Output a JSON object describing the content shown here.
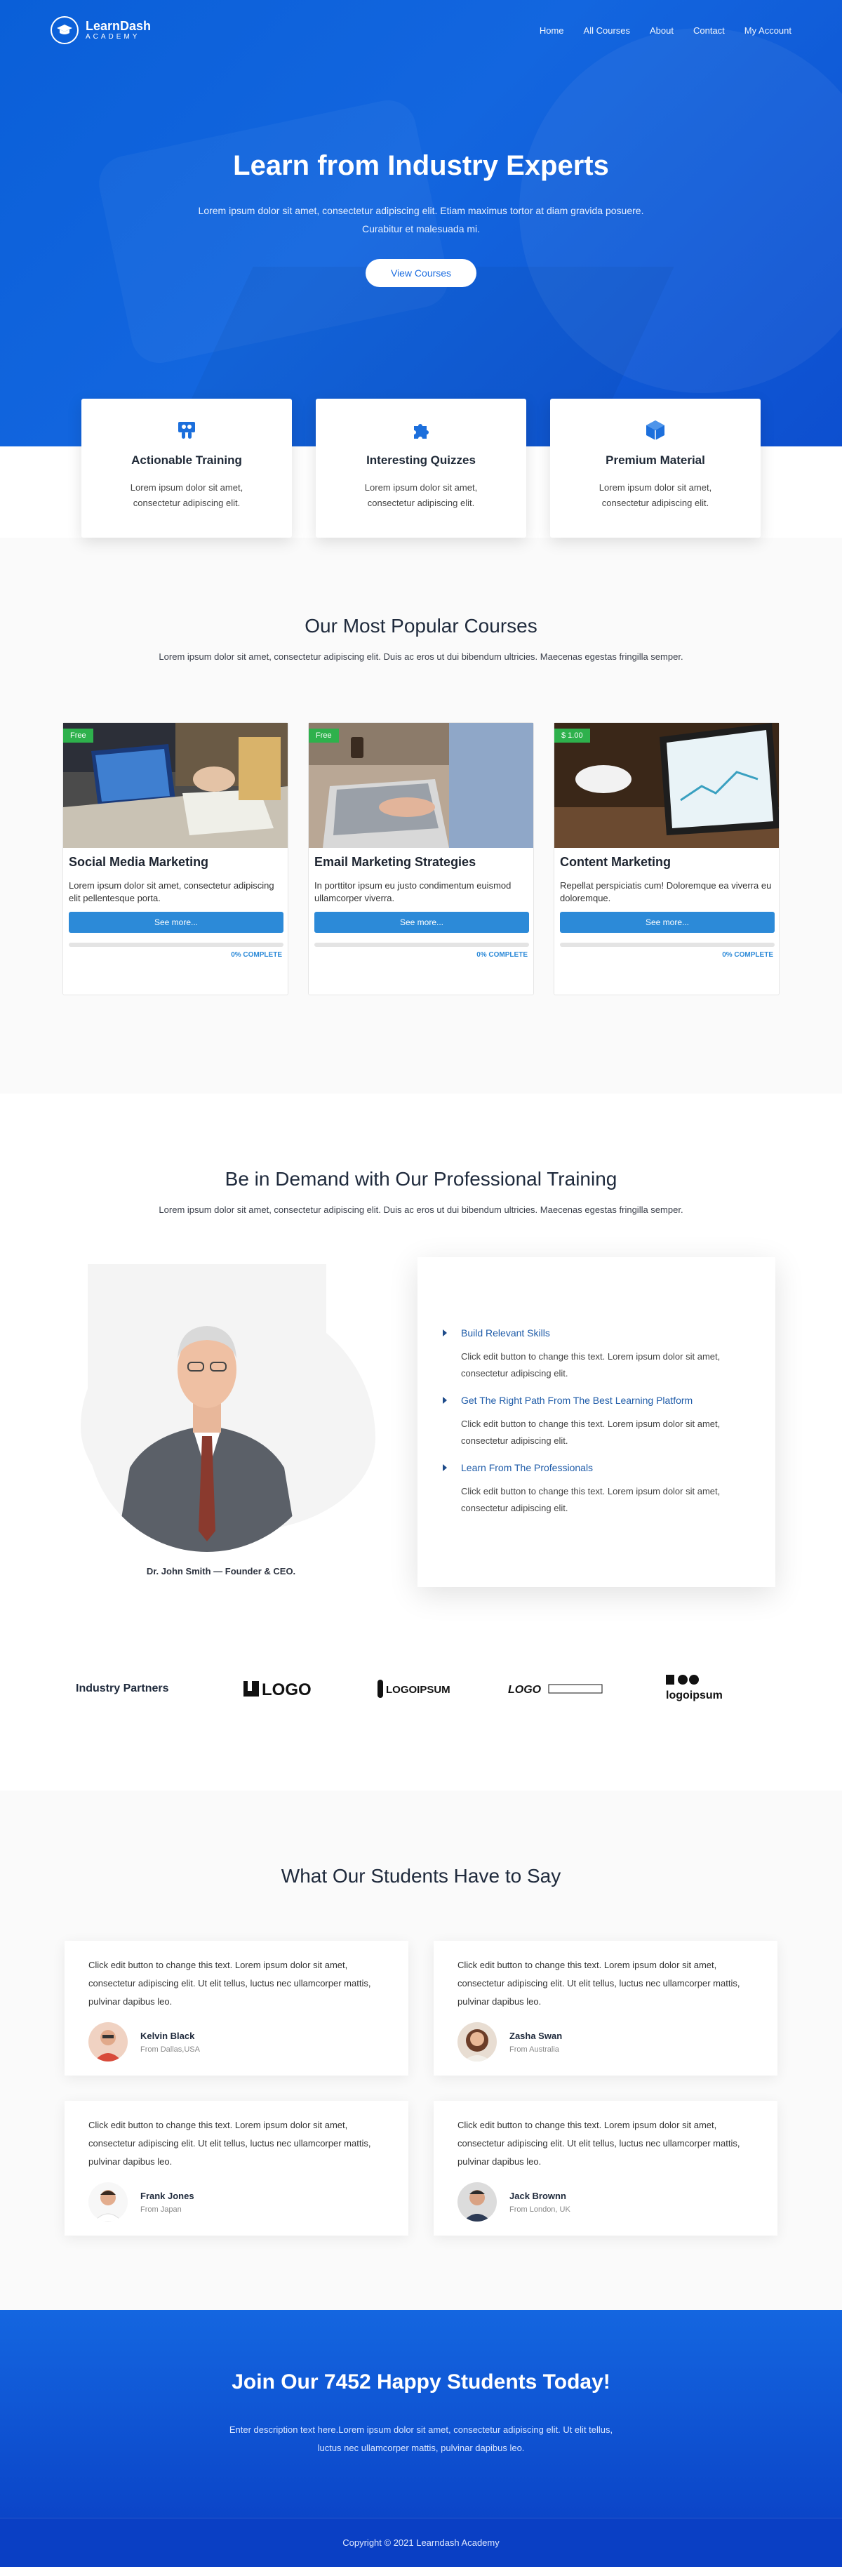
{
  "nav": {
    "logo_title": "LearnDash",
    "logo_sub": "ACADEMY",
    "links": [
      "Home",
      "All Courses",
      "About",
      "Contact",
      "My Account"
    ]
  },
  "hero": {
    "title": "Learn from Industry Experts",
    "text": "Lorem ipsum dolor sit amet, consectetur adipiscing elit. Etiam maximus tortor at diam gravida posuere. Curabitur et malesuada mi.",
    "button": "View Courses"
  },
  "features": [
    {
      "icon": "slideshare-icon",
      "title": "Actionable Training",
      "text": "Lorem ipsum dolor sit amet, consectetur adipiscing elit."
    },
    {
      "icon": "puzzle-icon",
      "title": "Interesting Quizzes",
      "text": "Lorem ipsum dolor sit amet, consectetur adipiscing elit."
    },
    {
      "icon": "cube-icon",
      "title": "Premium Material",
      "text": "Lorem ipsum dolor sit amet, consectetur adipiscing elit."
    }
  ],
  "courses_section": {
    "title": "Our Most Popular Courses",
    "subtitle": "Lorem ipsum dolor sit amet, consectetur adipiscing elit. Duis ac eros ut dui bibendum ultricies. Maecenas egestas fringilla semper."
  },
  "courses": [
    {
      "tag": "Free",
      "title": "Social Media Marketing",
      "text": "Lorem ipsum dolor sit amet, consectetur adipiscing elit pellentesque porta.",
      "button": "See more...",
      "progress_label": "0% COMPLETE",
      "progress": 0
    },
    {
      "tag": "Free",
      "title": "Email Marketing Strategies",
      "text": "In porttitor ipsum eu justo condimentum euismod ullamcorper viverra.",
      "button": "See more...",
      "progress_label": "0% COMPLETE",
      "progress": 0
    },
    {
      "tag": "$ 1.00",
      "title": "Content Marketing",
      "text": "Repellat perspiciatis cum! Doloremque ea viverra eu doloremque.",
      "button": "See more...",
      "progress_label": "0% COMPLETE",
      "progress": 0
    }
  ],
  "training_section": {
    "title": "Be in Demand with Our Professional Training",
    "subtitle": "Lorem ipsum dolor sit amet, consectetur adipiscing elit. Duis ac eros ut dui bibendum ultricies. Maecenas egestas fringilla semper.",
    "caption": "Dr. John Smith — Founder & CEO.",
    "items": [
      {
        "title": "Build Relevant Skills",
        "text": "Click edit button to change this text. Lorem ipsum dolor sit amet, consectetur adipiscing elit."
      },
      {
        "title": "Get The Right Path From The Best Learning Platform",
        "text": "Click edit button to change this text. Lorem ipsum dolor sit amet, consectetur adipiscing elit."
      },
      {
        "title": "Learn From The Professionals",
        "text": "Click edit button to change this text. Lorem ipsum dolor sit amet, consectetur adipiscing elit."
      }
    ]
  },
  "partners": {
    "title": "Industry Partners",
    "logos": [
      "LOGO",
      "LOGOIPSUM",
      "LOGO",
      "logoipsum"
    ]
  },
  "testimonials_section": {
    "title": "What Our Students Have to Say"
  },
  "testimonials": [
    {
      "text": "Click edit button to change this text. Lorem ipsum dolor sit amet, consectetur adipiscing elit. Ut elit tellus, luctus nec ullamcorper mattis, pulvinar dapibus leo.",
      "name": "Kelvin Black",
      "location": "From Dallas,USA"
    },
    {
      "text": "Click edit button to change this text. Lorem ipsum dolor sit amet, consectetur adipiscing elit. Ut elit tellus, luctus nec ullamcorper mattis, pulvinar dapibus leo.",
      "name": "Zasha Swan",
      "location": "From Australia"
    },
    {
      "text": "Click edit button to change this text. Lorem ipsum dolor sit amet, consectetur adipiscing elit. Ut elit tellus, luctus nec ullamcorper mattis, pulvinar dapibus leo.",
      "name": "Frank Jones",
      "location": "From Japan"
    },
    {
      "text": "Click edit button to change this text. Lorem ipsum dolor sit amet, consectetur adipiscing elit. Ut elit tellus, luctus nec ullamcorper mattis, pulvinar dapibus leo.",
      "name": "Jack Brownn",
      "location": "From London, UK"
    }
  ],
  "cta": {
    "title": "Join Our 7452 Happy Students Today!",
    "text": "Enter description text here.Lorem ipsum dolor sit amet, consectetur adipiscing elit. Ut elit tellus, luctus nec ullamcorper mattis, pulvinar dapibus leo."
  },
  "footer": {
    "copyright": "Copyright © 2021 Learndash Academy"
  },
  "colors": {
    "primary": "#1366df",
    "accent": "#2c8ad8",
    "tag_green": "#2eb14c"
  }
}
